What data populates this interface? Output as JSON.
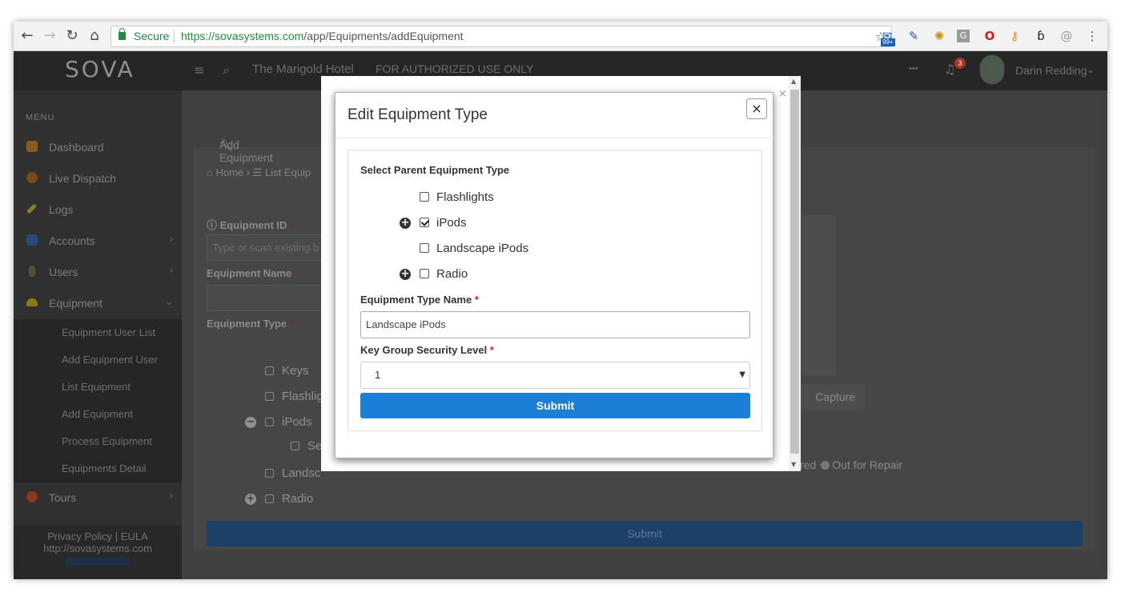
{
  "browser": {
    "secure_label": "Secure",
    "url_host": "https://sovasystems.com",
    "url_path": "/app/Equipments/addEquipment",
    "extension_badge": "99+"
  },
  "app": {
    "logo": "SOVA",
    "property": "The Marigold Hotel",
    "notice": "FOR AUTHORIZED USE ONLY",
    "more": "•••",
    "notification_count": "3",
    "user_name": "Darin Redding"
  },
  "sidebar": {
    "heading": "MENU",
    "items": [
      {
        "label": "Dashboard",
        "color": "#8a5a1a"
      },
      {
        "label": "Live Dispatch",
        "color": "#7a4a1a"
      },
      {
        "label": "Logs",
        "color": "#8a7a2a"
      },
      {
        "label": "Accounts",
        "color": "#2a4a7a"
      },
      {
        "label": "Users",
        "color": "#5a4a3a"
      },
      {
        "label": "Equipment",
        "color": "#8a7a1a"
      },
      {
        "label": "Tours",
        "color": "#8a3a1a"
      }
    ],
    "sub_items": [
      "Equipment User List",
      "Add Equipment User",
      "List Equipment",
      "Add Equipment",
      "Process Equipment",
      "Equipments Detail"
    ],
    "footer_links": "Privacy Policy | EULA",
    "footer_url": "http://sovasystems.com"
  },
  "page": {
    "header": "Add Equipment",
    "breadcrumb_home": "Home",
    "breadcrumb_list": "List Equip",
    "equipment_id_label": "Equipment ID",
    "equipment_id_placeholder": "Type or scan existing b",
    "equipment_name_label": "Equipment Name",
    "equipment_type_label": "Equipment Type",
    "required_mark": "*",
    "tree": [
      "Keys",
      "Flashlig",
      "iPods",
      "Se",
      "Landsc",
      "Radio"
    ],
    "capture_label": "Capture",
    "status_partial": "red",
    "status_repair": "Out for Repair",
    "submit_label": "Submit"
  },
  "modal": {
    "title": "Edit Equipment Type",
    "close_symbol": "×",
    "parent_label": "Select Parent Equipment Type",
    "parents": [
      {
        "label": "Flashlights",
        "checked": false,
        "expandable": false
      },
      {
        "label": "iPods",
        "checked": true,
        "expandable": true
      },
      {
        "label": "Landscape iPods",
        "checked": false,
        "expandable": false
      },
      {
        "label": "Radio",
        "checked": false,
        "expandable": true
      }
    ],
    "type_name_label": "Equipment Type Name",
    "type_name_value": "Landscape iPods",
    "security_label": "Key Group Security Level",
    "security_value": "1",
    "required_mark": "*",
    "submit_label": "Submit",
    "accent_color": "#1b7fd6"
  }
}
